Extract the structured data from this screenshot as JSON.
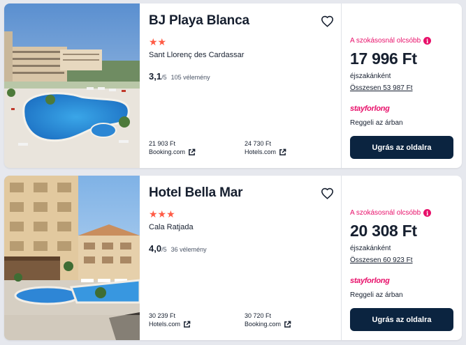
{
  "results": [
    {
      "hotel_name": "BJ Playa Blanca",
      "stars": "★★",
      "star_count": 2,
      "location": "Sant Llorenç des Cardassar",
      "rating_score": "3,1",
      "rating_scale": "/5",
      "review_count": "105 vélemény",
      "providers": [
        {
          "price": "21 903 Ft",
          "name": "Booking.com"
        },
        {
          "price": "24 730 Ft",
          "name": "Hotels.com"
        }
      ],
      "cheaper_label": "A szokásosnál olcsóbb",
      "price": "17 996 Ft",
      "per_night": "éjszakánként",
      "total": "Összesen 53 987 Ft",
      "partner": "stayforlong",
      "breakfast": "Reggeli az árban",
      "cta": "Ugrás az oldalra"
    },
    {
      "hotel_name": "Hotel Bella Mar",
      "stars": "★★★",
      "star_count": 3,
      "location": "Cala Ratjada",
      "rating_score": "4,0",
      "rating_scale": "/5",
      "review_count": "36 vélemény",
      "providers": [
        {
          "price": "30 239 Ft",
          "name": "Hotels.com"
        },
        {
          "price": "30 720 Ft",
          "name": "Booking.com"
        }
      ],
      "cheaper_label": "A szokásosnál olcsóbb",
      "price": "20 308 Ft",
      "per_night": "éjszakánként",
      "total": "Összesen 60 923 Ft",
      "partner": "stayforlong",
      "breakfast": "Reggeli az árban",
      "cta": "Ugrás az oldalra"
    }
  ],
  "icons": {
    "favorite": "heart-outline-icon",
    "external": "external-link-icon",
    "info": "info-icon"
  },
  "colors": {
    "accent_pink": "#e8106a",
    "star_red": "#ff5b45",
    "cta_navy": "#0b2440"
  }
}
